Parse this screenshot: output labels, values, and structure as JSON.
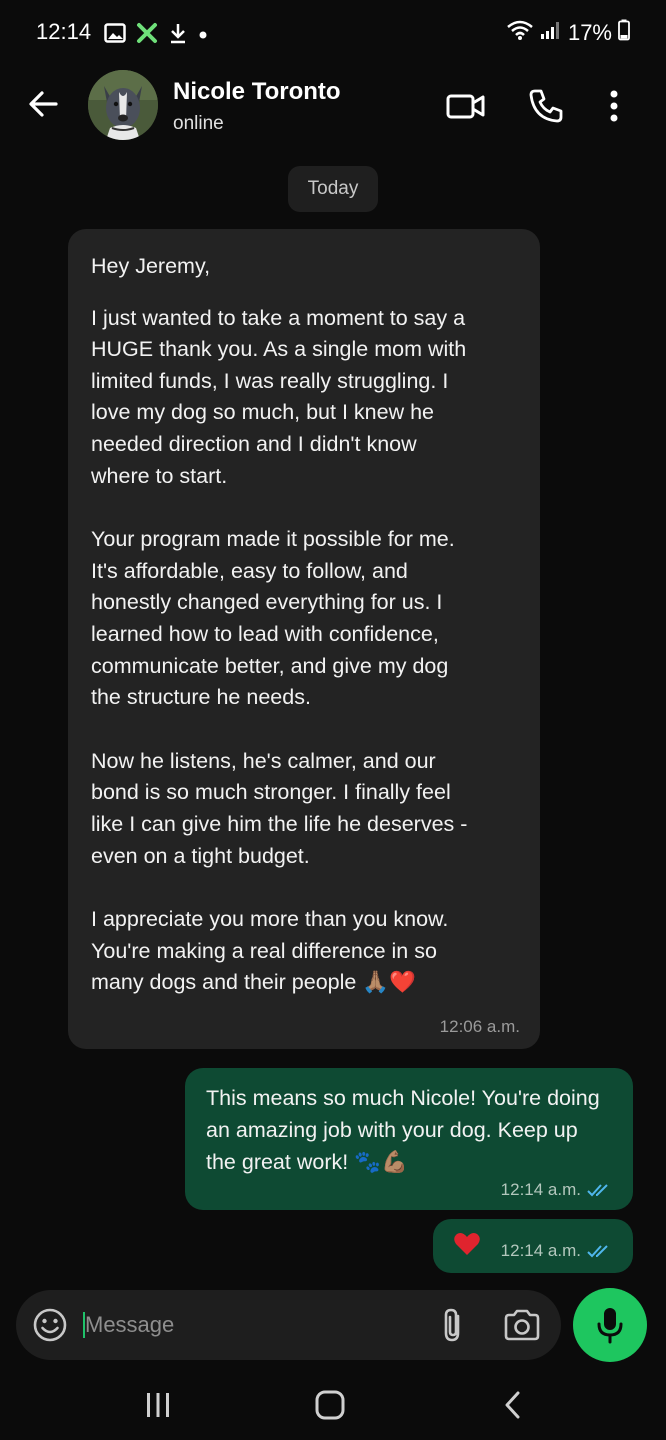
{
  "status_bar": {
    "time": "12:14",
    "battery": "17%"
  },
  "header": {
    "contact_name": "Nicole Toronto",
    "contact_status": "online"
  },
  "chat": {
    "date_label": "Today",
    "incoming": {
      "greeting": "Hey Jeremy,",
      "paragraphs": [
        "I just wanted to take a moment to say a\nHUGE thank you. As a single mom with\nlimited funds, I was really struggling. I\nlove my dog so much, but I knew he\nneeded direction and I didn't know\nwhere to start.",
        "Your program made it possible for me.\nIt's affordable, easy to follow, and\nhonestly changed everything for us. I\nlearned how to lead with confidence,\ncommunicate better, and give my dog\nthe structure he needs.",
        "Now he listens, he's calmer, and our\nbond is so much stronger. I finally feel\nlike I can give him the life he deserves -\neven on a tight budget.",
        "I appreciate you more than you know.\nYou're making a real difference in so\nmany dogs and their people 🙏🏽❤️"
      ],
      "time": "12:06 a.m."
    },
    "outgoing": [
      {
        "text": "This means so much Nicole! You're doing an amazing job with your dog. Keep up the great work! 🐾💪🏽",
        "time": "12:14 a.m.",
        "status": "read"
      },
      {
        "text": "❤️",
        "time": "12:14 a.m.",
        "status": "read"
      }
    ]
  },
  "composer": {
    "placeholder": "Message"
  },
  "colors": {
    "background": "#0b0b0b",
    "incoming_bubble": "#232323",
    "outgoing_bubble": "#0e4a33",
    "accent_green": "#1ec65f",
    "read_ticks": "#4fb6ec"
  }
}
